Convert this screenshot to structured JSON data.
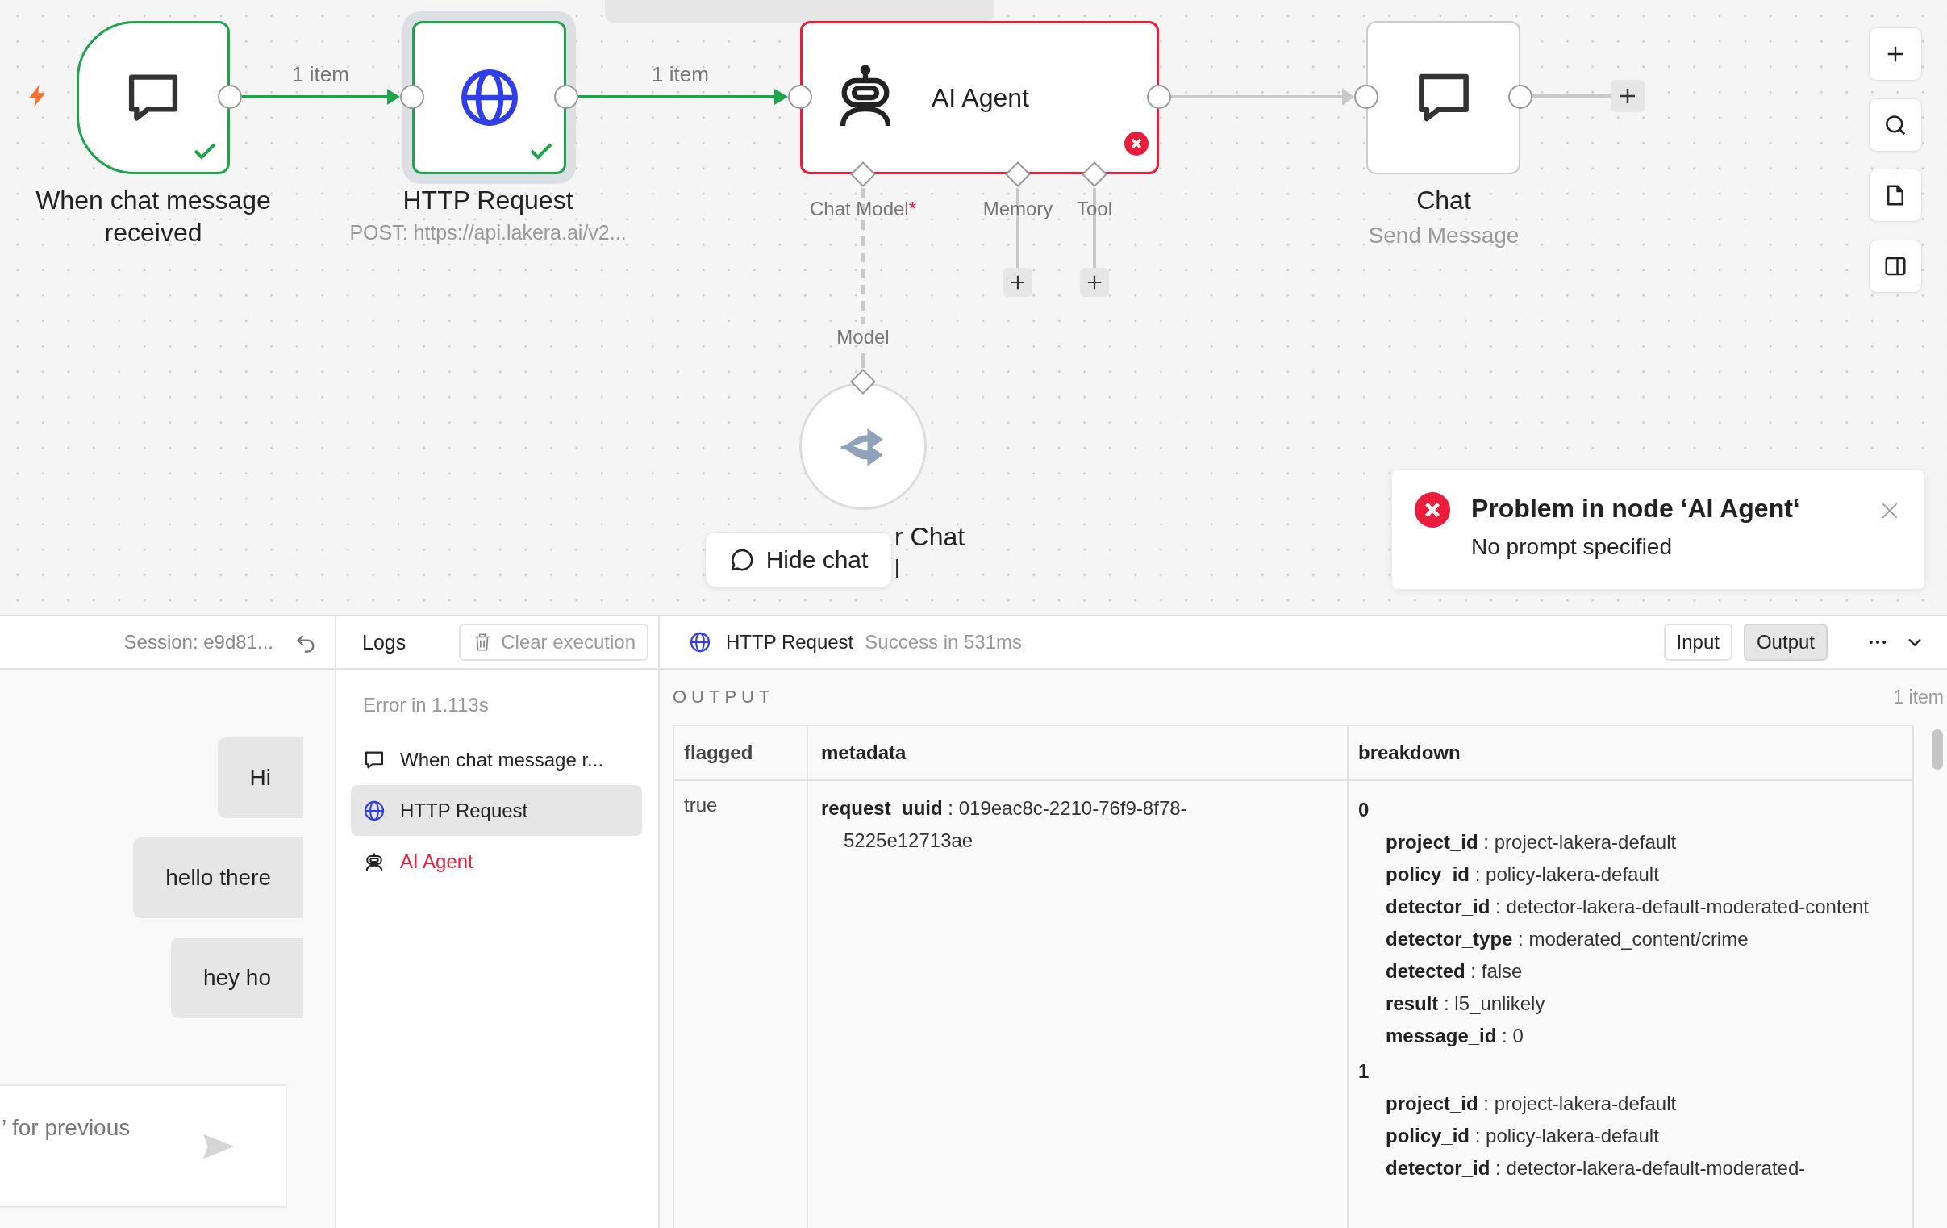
{
  "workflow": {
    "trigger": {
      "label": "When chat message received",
      "succeeded": true
    },
    "http": {
      "label": "HTTP Request",
      "subtitle": "POST: https://api.lakera.ai/v2...",
      "succeeded": true,
      "selected": true
    },
    "agent": {
      "label": "AI Agent",
      "failed": true,
      "ports": [
        {
          "label": "Chat Model",
          "required_mark": "*"
        },
        {
          "label": "Memory"
        },
        {
          "label": "Tool"
        }
      ]
    },
    "chat": {
      "label": "Chat",
      "subtitle": "Send Message"
    },
    "model": {
      "port_label": "Model",
      "label_fragments": [
        "r Chat",
        "l"
      ]
    },
    "edges": [
      {
        "label": "1 item",
        "active": true
      },
      {
        "label": "1 item",
        "active": true
      },
      {
        "active": false
      }
    ]
  },
  "toast": {
    "title": "Problem in node ‘AI Agent‘",
    "message": "No prompt specified"
  },
  "hide_chat_button": {
    "label": "Hide chat"
  },
  "chat_panel": {
    "session": "Session: e9d81...",
    "messages": [
      {
        "text": "Hi"
      },
      {
        "text": "hello there"
      },
      {
        "text": "hey ho"
      }
    ],
    "input": {
      "placeholder": "’ for previous"
    }
  },
  "logs": {
    "title": "Logs",
    "clear_button": "Clear execution",
    "summary": "Error in 1.113s",
    "entries": [
      {
        "kind": "chat",
        "label": "When chat message r...",
        "failed": false,
        "selected": false
      },
      {
        "kind": "http",
        "label": "HTTP Request",
        "failed": false,
        "selected": true
      },
      {
        "kind": "agent",
        "label": "AI Agent",
        "failed": true,
        "selected": false
      }
    ]
  },
  "output_panel": {
    "node_label": "HTTP Request",
    "status_text": "Success in 531ms",
    "views": [
      {
        "label": "Input",
        "selected": false
      },
      {
        "label": "Output",
        "selected": true
      }
    ],
    "section_title": "OUTPUT",
    "item_count": "1 item",
    "table": {
      "columns": [
        "flagged",
        "metadata",
        "breakdown"
      ],
      "rows": [
        {
          "flagged": "true",
          "metadata": [
            "**request_uuid** : 019eac8c-2210-76f9-8f78-5225e12713ae"
          ],
          "breakdown": [
            {
              "index": "0",
              "fields": [
                "**project_id** : project-lakera-default",
                "**policy_id** : policy-lakera-default",
                "**detector_id** : detector-lakera-default-moderated-content",
                "**detector_type** : moderated_content/crime",
                "**detected** : false",
                "**result** : l5_unlikely",
                "**message_id** : 0"
              ]
            },
            {
              "index": "1",
              "fields": [
                "**project_id** : project-lakera-default",
                "**policy_id** : policy-lakera-default",
                "**detector_id** : detector-lakera-default-moderated-"
              ]
            }
          ]
        }
      ]
    }
  }
}
